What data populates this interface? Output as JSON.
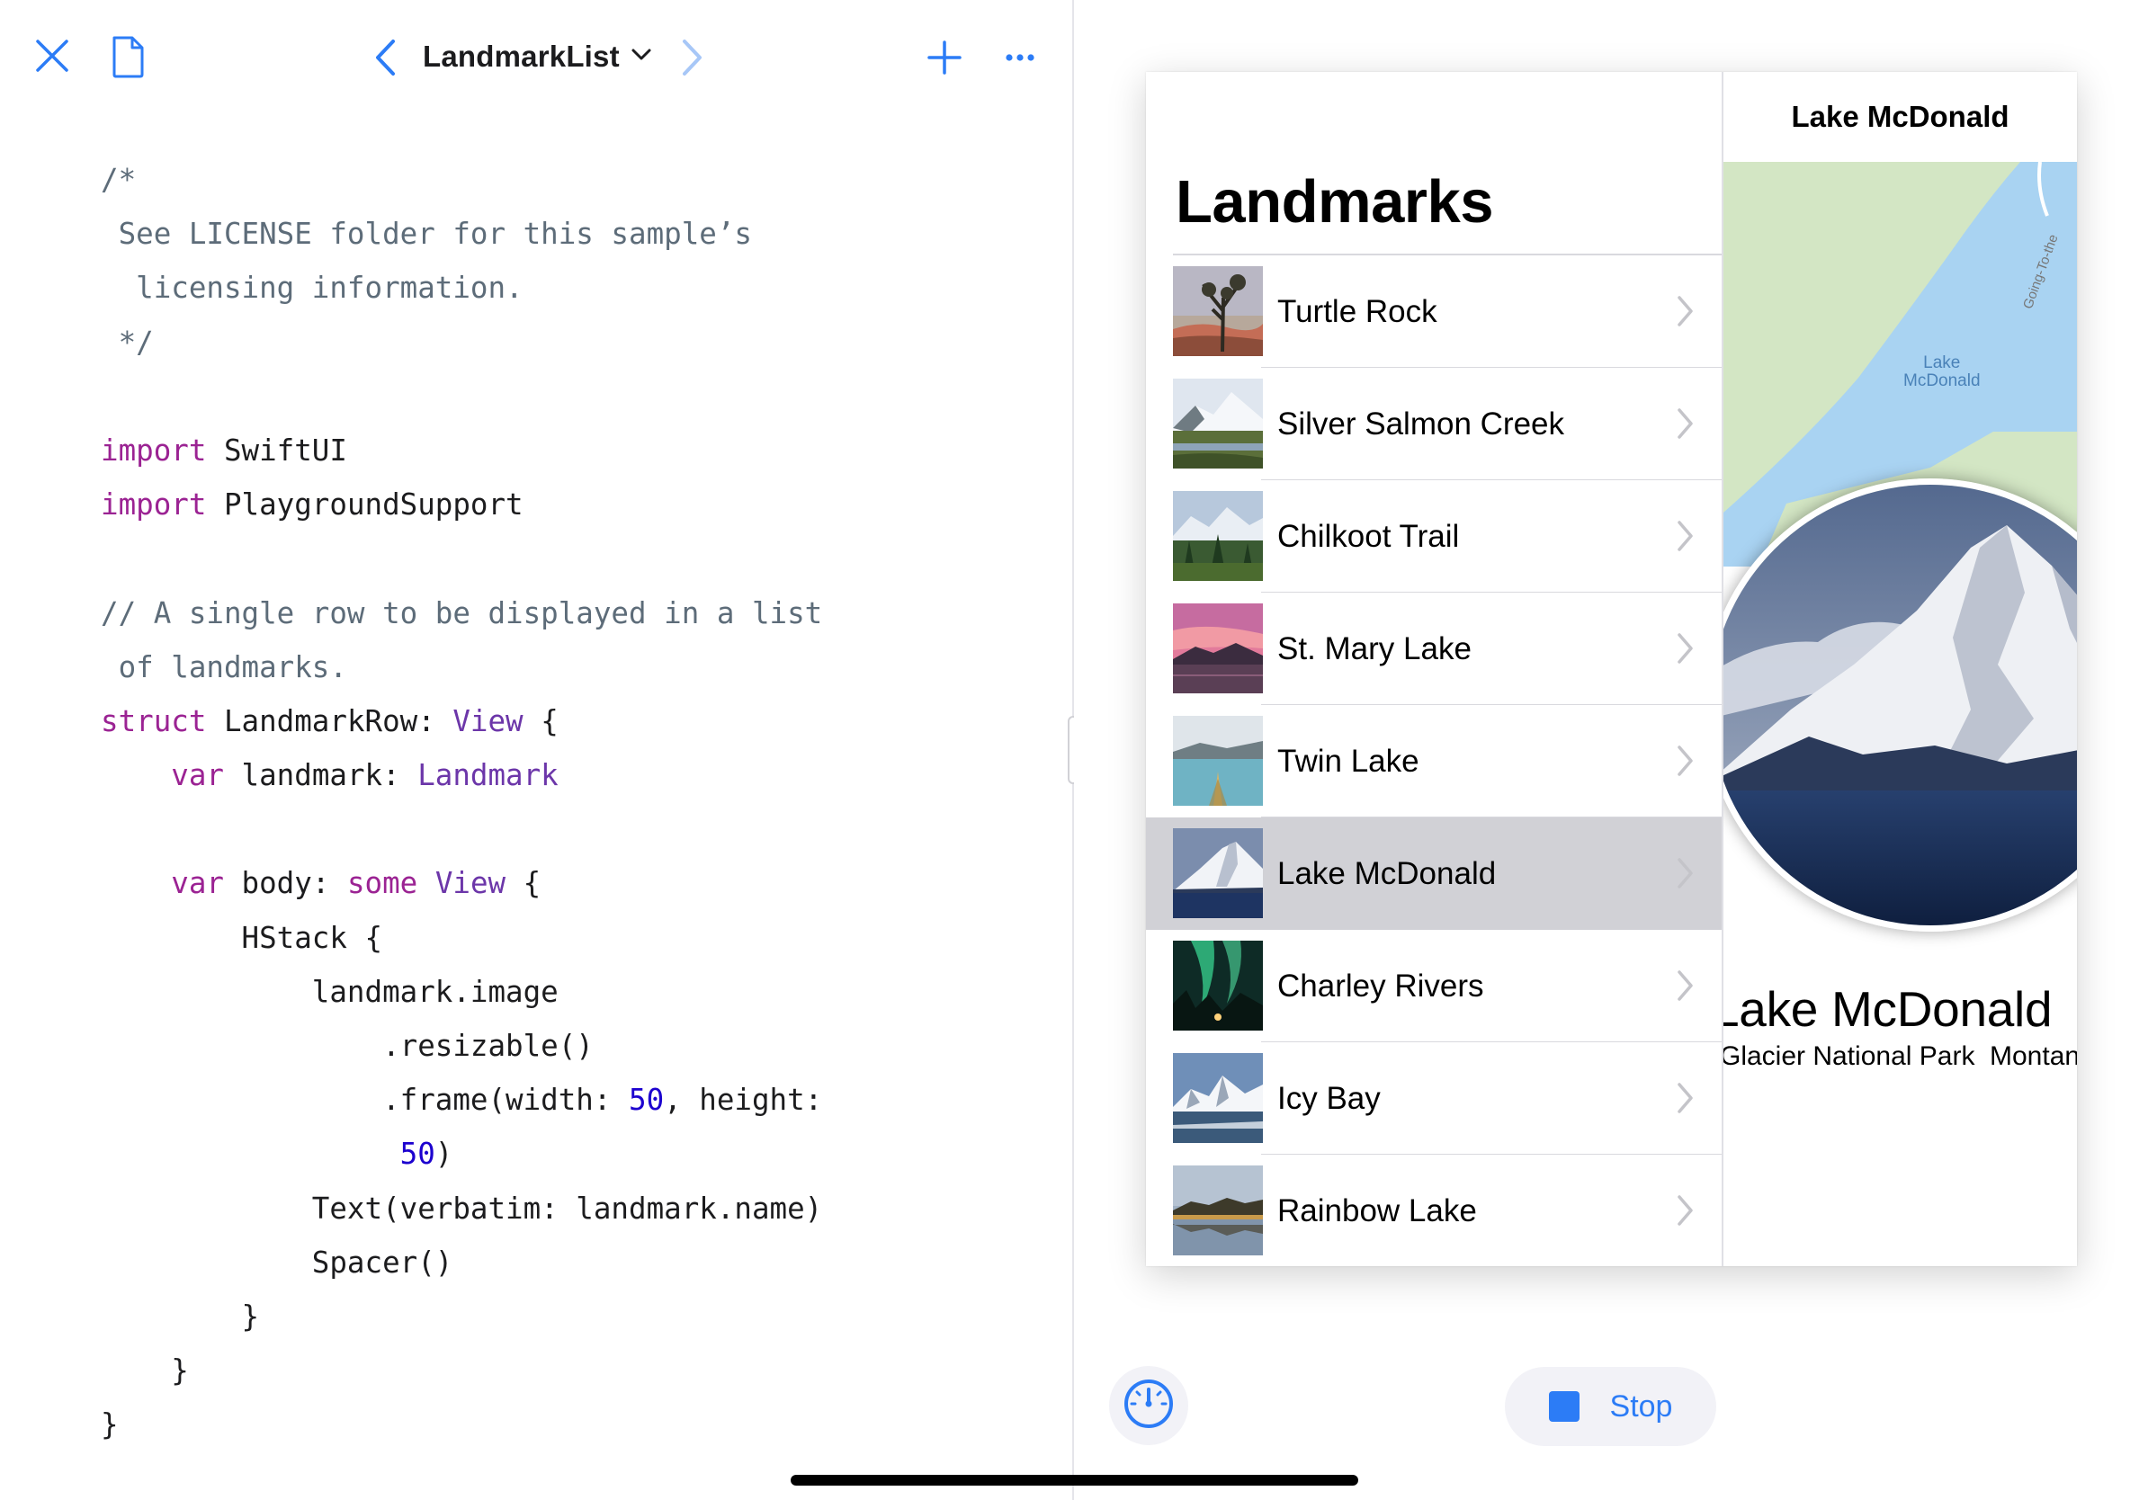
{
  "colors": {
    "tint": "#2c7cf6",
    "code_comment": "#5d6c79",
    "code_keyword": "#9b2393",
    "code_type": "#6c36a9",
    "code_number": "#1c00cf",
    "selection": "#d1d1d6"
  },
  "editor": {
    "file_title": "LandmarkList",
    "icons": {
      "close": "close-icon",
      "document": "document-icon",
      "back": "chevron-left-icon",
      "title_menu": "chevron-down-icon",
      "forward": "chevron-right-icon",
      "add": "plus-icon",
      "more": "ellipsis-icon"
    },
    "code_lines": [
      [
        {
          "t": "comment",
          "s": "/*"
        }
      ],
      [
        {
          "t": "comment",
          "s": " See LICENSE folder for this sample’s"
        }
      ],
      [
        {
          "t": "comment",
          "s": "  licensing information."
        }
      ],
      [
        {
          "t": "comment",
          "s": " */"
        }
      ],
      [],
      [
        {
          "t": "keyword",
          "s": "import"
        },
        {
          "t": "plain",
          "s": " SwiftUI"
        }
      ],
      [
        {
          "t": "keyword",
          "s": "import"
        },
        {
          "t": "plain",
          "s": " PlaygroundSupport"
        }
      ],
      [],
      [
        {
          "t": "comment",
          "s": "// A single row to be displayed in a list"
        }
      ],
      [
        {
          "t": "comment",
          "s": " of landmarks."
        }
      ],
      [
        {
          "t": "keyword",
          "s": "struct"
        },
        {
          "t": "plain",
          "s": " LandmarkRow: "
        },
        {
          "t": "type",
          "s": "View"
        },
        {
          "t": "plain",
          "s": " {"
        }
      ],
      [
        {
          "t": "plain",
          "s": "    "
        },
        {
          "t": "keyword",
          "s": "var"
        },
        {
          "t": "plain",
          "s": " landmark: "
        },
        {
          "t": "type",
          "s": "Landmark"
        }
      ],
      [],
      [
        {
          "t": "plain",
          "s": "    "
        },
        {
          "t": "keyword",
          "s": "var"
        },
        {
          "t": "plain",
          "s": " body: "
        },
        {
          "t": "keyword",
          "s": "some"
        },
        {
          "t": "plain",
          "s": " "
        },
        {
          "t": "type",
          "s": "View"
        },
        {
          "t": "plain",
          "s": " {"
        }
      ],
      [
        {
          "t": "plain",
          "s": "        HStack {"
        }
      ],
      [
        {
          "t": "plain",
          "s": "            landmark.image"
        }
      ],
      [
        {
          "t": "plain",
          "s": "                .resizable()"
        }
      ],
      [
        {
          "t": "plain",
          "s": "                .frame(width: "
        },
        {
          "t": "number",
          "s": "50"
        },
        {
          "t": "plain",
          "s": ", height:"
        }
      ],
      [
        {
          "t": "plain",
          "s": "                 "
        },
        {
          "t": "number",
          "s": "50"
        },
        {
          "t": "plain",
          "s": ")"
        }
      ],
      [
        {
          "t": "plain",
          "s": "            Text(verbatim: landmark.name)"
        }
      ],
      [
        {
          "t": "plain",
          "s": "            Spacer()"
        }
      ],
      [
        {
          "t": "plain",
          "s": "        }"
        }
      ],
      [
        {
          "t": "plain",
          "s": "    }"
        }
      ],
      [
        {
          "t": "plain",
          "s": "}"
        }
      ]
    ]
  },
  "live_view": {
    "master_title": "Landmarks",
    "rows": [
      {
        "label": "Turtle Rock",
        "thumb": "desert",
        "selected": false
      },
      {
        "label": "Silver Salmon Creek",
        "thumb": "meadow",
        "selected": false
      },
      {
        "label": "Chilkoot Trail",
        "thumb": "forest",
        "selected": false
      },
      {
        "label": "St. Mary Lake",
        "thumb": "sunset",
        "selected": false
      },
      {
        "label": "Twin Lake",
        "thumb": "kayak",
        "selected": false
      },
      {
        "label": "Lake McDonald",
        "thumb": "mountain",
        "selected": true
      },
      {
        "label": "Charley Rivers",
        "thumb": "aurora",
        "selected": false
      },
      {
        "label": "Icy Bay",
        "thumb": "glacier",
        "selected": false
      },
      {
        "label": "Rainbow Lake",
        "thumb": "reflection",
        "selected": false
      }
    ],
    "detail": {
      "nav_title": "Lake McDonald",
      "map_lake_label_line1": "Lake",
      "map_lake_label_line2": "McDonald",
      "map_road_label": "Going-To-the",
      "name": "Lake McDonald",
      "park": "Glacier National Park",
      "state": "Montana"
    }
  },
  "controls": {
    "gauge_icon": "gauge-icon",
    "stop_icon": "stop-square-icon",
    "stop_label": "Stop"
  }
}
